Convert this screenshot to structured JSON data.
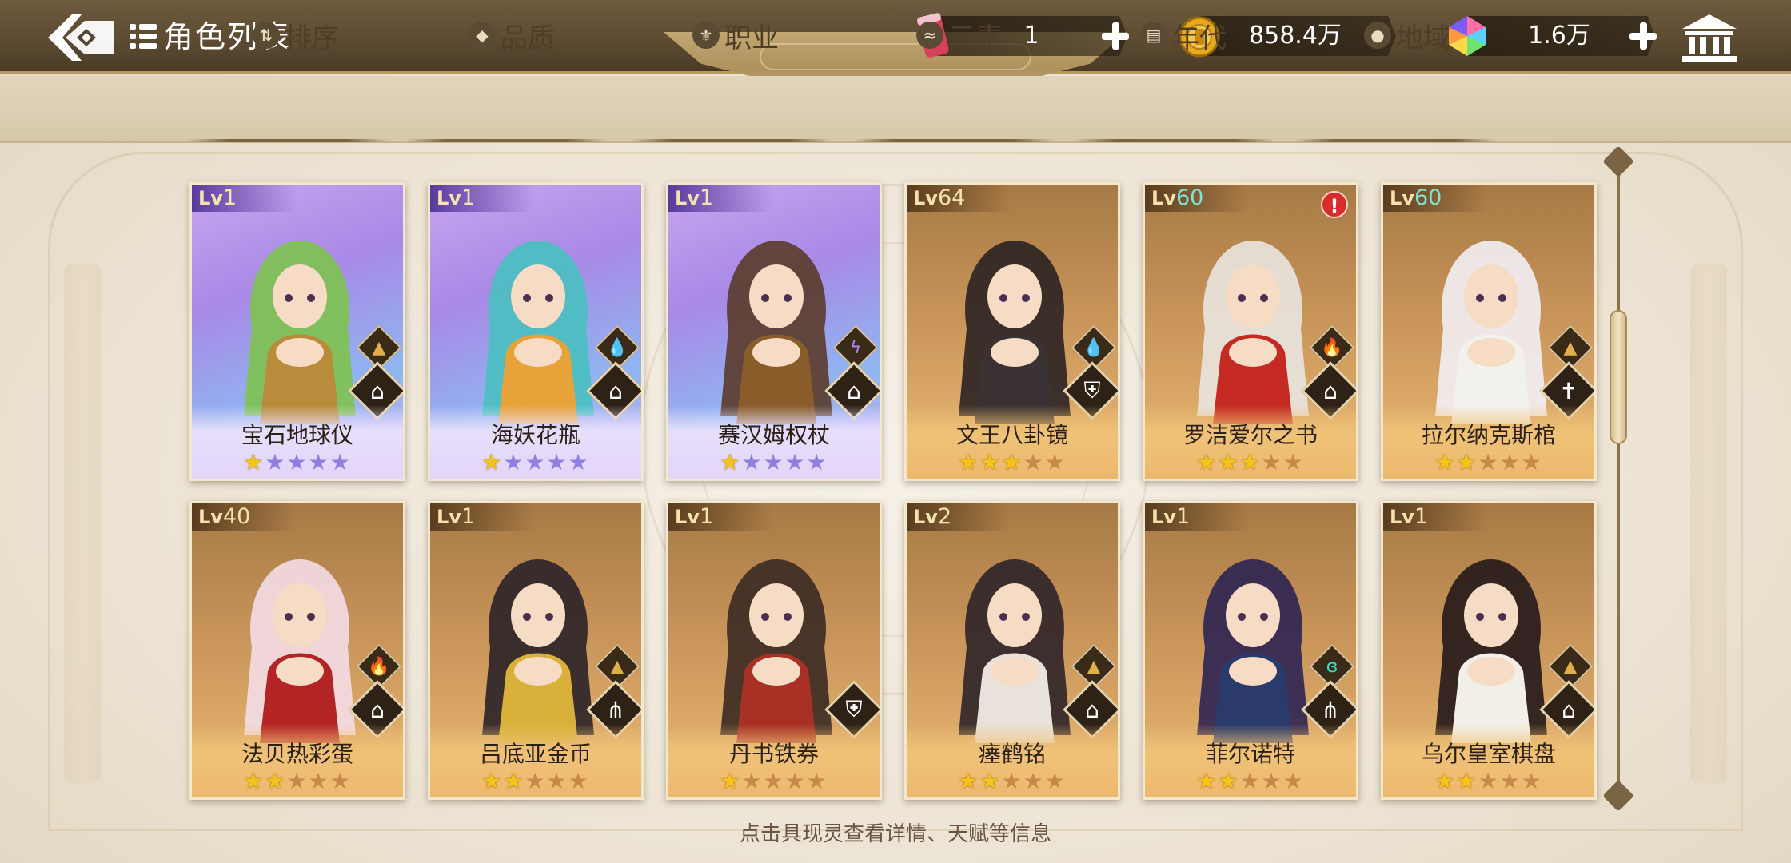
{
  "header": {
    "title": "角色列表",
    "back_icon": "back-arrow-icon",
    "list_icon": "list-icon",
    "resources": [
      {
        "name": "ticket",
        "icon": "ticket-can-icon",
        "value": "1"
      },
      {
        "name": "gold",
        "icon": "gold-coin-icon",
        "value": "858.4万"
      },
      {
        "name": "gem",
        "icon": "rainbow-gem-icon",
        "value": "1.6万"
      }
    ],
    "bank_icon": "bank-icon"
  },
  "tabs": [
    {
      "label": "排序",
      "icon": "sort-icon"
    },
    {
      "label": "品质",
      "icon": "quality-icon"
    },
    {
      "label": "职业",
      "icon": "class-icon"
    },
    {
      "label": "元素",
      "icon": "element-icon"
    },
    {
      "label": "年代",
      "icon": "era-icon"
    },
    {
      "label": "地域",
      "icon": "location-pin-icon"
    }
  ],
  "cards": [
    {
      "lv_prefix": "Lv",
      "lv": "1",
      "name": "宝石地球仪",
      "stars": 1,
      "rarity": "purple",
      "element": "earth",
      "class": "book",
      "alert": false
    },
    {
      "lv_prefix": "Lv",
      "lv": "1",
      "name": "海妖花瓶",
      "stars": 1,
      "rarity": "purple",
      "element": "water",
      "class": "book",
      "alert": false
    },
    {
      "lv_prefix": "Lv",
      "lv": "1",
      "name": "赛汉姆权杖",
      "stars": 1,
      "rarity": "purple",
      "element": "light",
      "class": "book",
      "alert": false
    },
    {
      "lv_prefix": "Lv",
      "lv": "64",
      "name": "文王八卦镜",
      "stars": 3,
      "rarity": "gold",
      "element": "water",
      "class": "shield",
      "alert": false
    },
    {
      "lv_prefix": "Lv",
      "lv": "60",
      "name": "罗洁爱尔之书",
      "stars": 3,
      "rarity": "gold",
      "element": "fire",
      "class": "book",
      "alert": true,
      "alert_text": "!"
    },
    {
      "lv_prefix": "Lv",
      "lv": "60",
      "name": "拉尔纳克斯棺",
      "stars": 2,
      "rarity": "gold",
      "element": "earth",
      "class": "cross",
      "alert": false
    },
    {
      "lv_prefix": "Lv",
      "lv": "40",
      "name": "法贝热彩蛋",
      "stars": 2,
      "rarity": "gold",
      "element": "fire",
      "class": "book",
      "alert": false
    },
    {
      "lv_prefix": "Lv",
      "lv": "1",
      "name": "吕底亚金币",
      "stars": 2,
      "rarity": "gold",
      "element": "earth",
      "class": "spear",
      "alert": false
    },
    {
      "lv_prefix": "Lv",
      "lv": "1",
      "name": "丹书铁券",
      "stars": 1,
      "rarity": "gold",
      "element": "none",
      "class": "shield",
      "alert": false
    },
    {
      "lv_prefix": "Lv",
      "lv": "2",
      "name": "瘗鹤铭",
      "stars": 2,
      "rarity": "gold",
      "element": "earth",
      "class": "book",
      "alert": false
    },
    {
      "lv_prefix": "Lv",
      "lv": "1",
      "name": "菲尔诺特",
      "stars": 2,
      "rarity": "gold",
      "element": "wind",
      "class": "spear",
      "alert": false
    },
    {
      "lv_prefix": "Lv",
      "lv": "1",
      "name": "乌尔皇室棋盘",
      "stars": 2,
      "rarity": "gold",
      "element": "earth",
      "class": "book",
      "alert": false
    }
  ],
  "hint": "点击具现灵查看详情、天赋等信息",
  "colors": {
    "header_bg": "#58472f",
    "tab_bg": "#d8c8aa",
    "purple_card": "#a889e6",
    "gold_card": "#c8945a",
    "star": "#f6c21c",
    "high_level": "#7fe3d8"
  }
}
